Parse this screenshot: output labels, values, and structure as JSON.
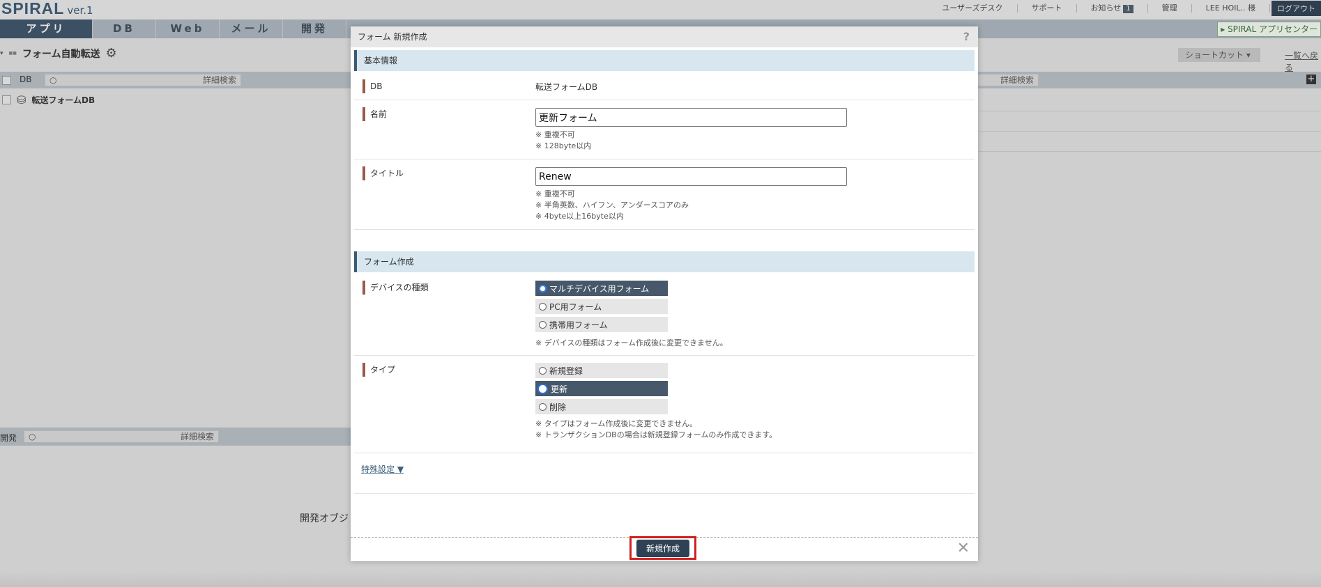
{
  "app": {
    "logo": "SPIRAL",
    "version": "ver.1",
    "top_links": [
      "ユーザーズデスク",
      "サポート",
      "お知らせ",
      "管理",
      "LEE HOIL.. 様"
    ],
    "notice_count": "1",
    "logout": "ログアウト",
    "nav_tabs": [
      "アプリ",
      "DB",
      "Web",
      "メール",
      "開発"
    ],
    "app_center": "SPIRAL アプリセンター",
    "page_title": "フォーム自動転送",
    "shortcut": "ショートカット",
    "back_link": "一覧へ戻る",
    "list_col_db": "DB",
    "detail_search": "詳細検索",
    "db_row": "転送フォームDB",
    "dev_label": "開発",
    "dev_empty": "開発オブジ"
  },
  "modal": {
    "title": "フォーム 新規作成",
    "help": "?",
    "section_basic": "基本情報",
    "db_label": "DB",
    "db_value": "転送フォームDB",
    "name_label": "名前",
    "name_value": "更新フォーム",
    "name_notes": [
      "※ 重複不可",
      "※ 128byte以内"
    ],
    "title_label": "タイトル",
    "title_value": "Renew",
    "title_notes": [
      "※ 重複不可",
      "※ 半角英数、ハイフン、アンダースコアのみ",
      "※ 4byte以上16byte以内"
    ],
    "section_form": "フォーム作成",
    "device_label": "デバイスの種類",
    "device_options": [
      "マルチデバイス用フォーム",
      "PC用フォーム",
      "携帯用フォーム"
    ],
    "device_note": "※ デバイスの種類はフォーム作成後に変更できません。",
    "type_label": "タイプ",
    "type_options": [
      "新規登録",
      "更新",
      "削除"
    ],
    "type_notes": [
      "※ タイプはフォーム作成後に変更できません。",
      "※ トランザクションDBの場合は新規登録フォームのみ作成できます。"
    ],
    "special": "特殊設定 ▼",
    "create_button": "新規作成"
  }
}
